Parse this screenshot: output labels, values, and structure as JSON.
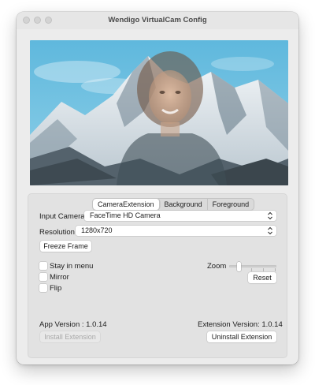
{
  "window": {
    "title": "Wendigo VirtualCam Config"
  },
  "preview": {
    "description_icon": "camera-preview",
    "sky_color": "#6fc3e2",
    "progress_note": null
  },
  "tabs": [
    {
      "label": "CameraExtension",
      "active": true
    },
    {
      "label": "Background",
      "active": false
    },
    {
      "label": "Foreground",
      "active": false
    }
  ],
  "form": {
    "input_camera_label": "Input Camera",
    "input_camera_value": "FaceTime HD Camera",
    "resolution_label": "Resolution",
    "resolution_value": "1280x720",
    "freeze_frame_label": "Freeze Frame"
  },
  "options": {
    "stay_in_menu_label": "Stay in menu",
    "stay_in_menu_checked": false,
    "mirror_label": "Mirror",
    "mirror_checked": false,
    "flip_label": "Flip",
    "flip_checked": false
  },
  "zoom": {
    "label": "Zoom",
    "level": 0.1,
    "reset_label": "Reset"
  },
  "versions": {
    "app_version_text": "App Version : 1.0.14",
    "extension_version_text": "Extension Version:  1.0.14"
  },
  "actions": {
    "install_label": "Install Extension",
    "install_enabled": false,
    "uninstall_label": "Uninstall Extension"
  }
}
